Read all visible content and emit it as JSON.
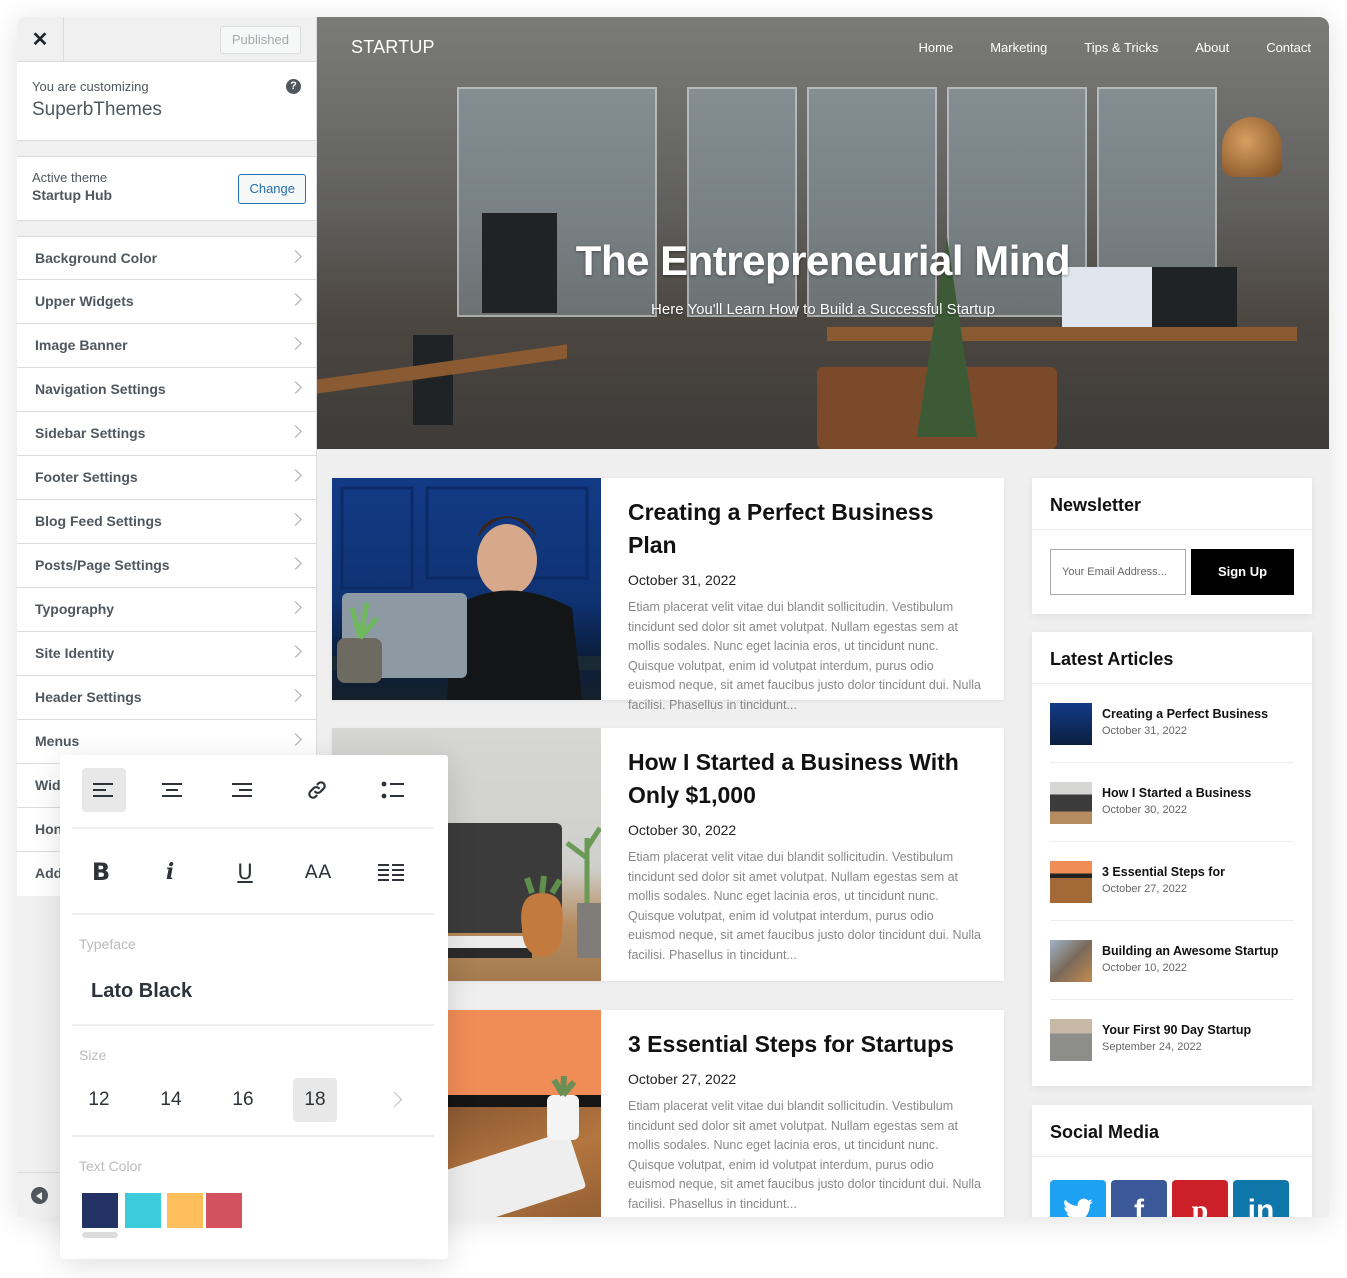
{
  "customizer": {
    "published_label": "Published",
    "customizing_label": "You are customizing",
    "site_name": "SuperbThemes",
    "active_theme_label": "Active theme",
    "active_theme_name": "Startup Hub",
    "change_label": "Change",
    "help_icon": "?",
    "close_icon": "✕",
    "menu_items": [
      {
        "label": "Background Color"
      },
      {
        "label": "Upper Widgets"
      },
      {
        "label": "Image Banner"
      },
      {
        "label": "Navigation Settings"
      },
      {
        "label": "Sidebar Settings"
      },
      {
        "label": "Footer Settings"
      },
      {
        "label": "Blog Feed Settings"
      },
      {
        "label": "Posts/Page Settings"
      },
      {
        "label": "Typography"
      },
      {
        "label": "Site Identity"
      },
      {
        "label": "Header Settings"
      },
      {
        "label": "Menus"
      },
      {
        "label": "Wid"
      },
      {
        "label": "Hon"
      },
      {
        "label": "Add"
      }
    ]
  },
  "site": {
    "logo": "STARTUP",
    "nav": [
      "Home",
      "Marketing",
      "Tips & Tricks",
      "About",
      "Contact"
    ],
    "hero_title": "The Entrepreneurial Mind",
    "hero_subtitle": "Here You'll Learn How to Build a Successful Startup",
    "posts": [
      {
        "title": "Creating a Perfect Business Plan",
        "date": "October 31, 2022",
        "excerpt": "Etiam placerat velit vitae dui blandit sollicitudin. Vestibulum tincidunt sed dolor sit amet volutpat. Nullam egestas sem at mollis sodales. Nunc eget lacinia eros, ut tincidunt nunc. Quisque volutpat, enim id volutpat interdum, purus odio euismod neque, sit amet faucibus justo dolor tincidunt dui. Nulla facilisi. Phasellus in tincidunt..."
      },
      {
        "title": "How I Started a Business With Only $1,000",
        "date": "October 30, 2022",
        "excerpt": "Etiam placerat velit vitae dui blandit sollicitudin. Vestibulum tincidunt sed dolor sit amet volutpat. Nullam egestas sem at mollis sodales. Nunc eget lacinia eros, ut tincidunt nunc. Quisque volutpat, enim id volutpat interdum, purus odio euismod neque, sit amet faucibus justo dolor tincidunt dui. Nulla facilisi. Phasellus in tincidunt..."
      },
      {
        "title": "3 Essential Steps for Startups",
        "date": "October 27, 2022",
        "excerpt": "Etiam placerat velit vitae dui blandit sollicitudin. Vestibulum tincidunt sed dolor sit amet volutpat. Nullam egestas sem at mollis sodales. Nunc eget lacinia eros, ut tincidunt nunc. Quisque volutpat, enim id volutpat interdum, purus odio euismod neque, sit amet faucibus justo dolor tincidunt dui. Nulla facilisi. Phasellus in tincidunt..."
      }
    ],
    "newsletter": {
      "title": "Newsletter",
      "placeholder": "Your Email Address...",
      "button": "Sign Up"
    },
    "latest_articles": {
      "title": "Latest Articles",
      "items": [
        {
          "title": "Creating a Perfect Business",
          "date": "October 31, 2022"
        },
        {
          "title": "How I Started a Business",
          "date": "October 30, 2022"
        },
        {
          "title": "3 Essential Steps for",
          "date": "October 27, 2022"
        },
        {
          "title": "Building an Awesome Startup",
          "date": "October 10, 2022"
        },
        {
          "title": "Your First 90 Day Startup",
          "date": "September 24, 2022"
        }
      ]
    },
    "social": {
      "title": "Social Media",
      "networks": [
        {
          "name": "twitter",
          "glyph": "🐦",
          "color": "#1da1f2"
        },
        {
          "name": "facebook",
          "glyph": "f",
          "color": "#3b5998"
        },
        {
          "name": "pinterest",
          "glyph": "p",
          "color": "#cb2027"
        },
        {
          "name": "linkedin",
          "glyph": "in",
          "color": "#0e76a8"
        }
      ]
    }
  },
  "typography_popover": {
    "alignment_tools": [
      "align-left",
      "align-center",
      "align-right",
      "link",
      "bullet-list"
    ],
    "active_alignment": "align-left",
    "style_tools": [
      {
        "name": "bold",
        "glyph": "B"
      },
      {
        "name": "italic",
        "glyph": "i"
      },
      {
        "name": "underline",
        "glyph": "U"
      },
      {
        "name": "uppercase",
        "glyph": "AA"
      },
      {
        "name": "justify",
        "glyph": "≣"
      }
    ],
    "typeface_label": "Typeface",
    "typeface_value": "Lato Black",
    "size_label": "Size",
    "sizes": [
      "12",
      "14",
      "16",
      "18"
    ],
    "selected_size": "18",
    "text_color_label": "Text Color",
    "colors": [
      "#243163",
      "#3ccbda",
      "#ffbe5c",
      "#d4525f"
    ],
    "selected_color": "#243163"
  }
}
